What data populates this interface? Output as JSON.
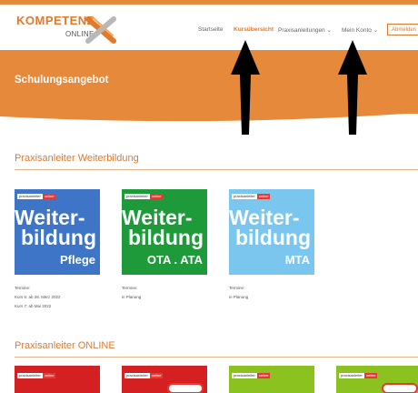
{
  "header": {
    "logo_top": "KOMPETENZ",
    "logo_bottom": "ONLINE",
    "nav": [
      {
        "label": "Startseite"
      },
      {
        "label": "Kursübersicht"
      },
      {
        "label": "Praxisanleitungen ⌄"
      },
      {
        "label": "Mein Konto ⌄"
      }
    ],
    "logout_label": "Abmelden"
  },
  "banner": {
    "title": "Schulungsangebot"
  },
  "sections": [
    {
      "title": "Praxisanleiter Weiterbildung"
    },
    {
      "title": "Praxisanleiter ONLINE"
    }
  ],
  "courses": [
    {
      "badge1": "praxisanleiter",
      "badge2": "online",
      "word1": "Weiter-",
      "word2": "bildung",
      "word3": "Pflege",
      "color": "#3f75c6",
      "caption": [
        "Termine:",
        "Kurs 6: ab 28. März 2022",
        "Kurs 7: ab Mai 2022"
      ]
    },
    {
      "badge1": "praxisanleiter",
      "badge2": "online",
      "word1": "Weiter-",
      "word2": "bildung",
      "word3": "OTA . ATA",
      "color": "#1f9a3a",
      "caption": [
        "Termine:",
        "in Planung"
      ]
    },
    {
      "badge1": "praxisanleiter",
      "badge2": "online",
      "word1": "Weiter-",
      "word2": "bildung",
      "word3": "MTA",
      "color": "#7bc6ef",
      "caption": [
        "Termine:",
        "in Planung"
      ]
    }
  ],
  "online_tiles": [
    {
      "badge1": "praxisanleiter",
      "badge2": "online",
      "color": "#d42020",
      "stamp": false
    },
    {
      "badge1": "praxisanleiter",
      "badge2": "online",
      "color": "#d42020",
      "stamp": true
    },
    {
      "badge1": "praxisanleiter",
      "badge2": "online",
      "color": "#8cc21f",
      "stamp": false
    },
    {
      "badge1": "praxisanleiter",
      "badge2": "online",
      "color": "#8cc21f",
      "stamp": true
    }
  ],
  "colors": {
    "accent": "#e07a2c",
    "banner": "#e7893b"
  },
  "icons": {
    "logo_mark": "x-logo-icon",
    "annotation": "arrow-up-icon"
  }
}
